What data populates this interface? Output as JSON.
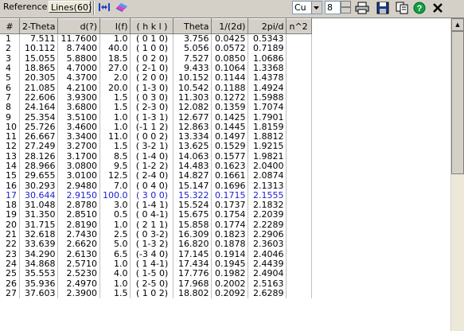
{
  "toolbar": {
    "reference_tab": "Reference",
    "lines_tab": "Lines(60)",
    "radiation": "Cu",
    "font_size": "8",
    "icons": [
      "fit-width-icon",
      "eraser-icon",
      "print-icon",
      "save-icon",
      "copy-icon",
      "help-icon",
      "close-icon"
    ]
  },
  "table": {
    "headers": [
      "#",
      "2-Theta",
      "d(?)",
      "I(f)",
      "( h k l )",
      "Theta",
      "1/(2d)",
      "2pi/d",
      "n^2"
    ],
    "selected_row": 17,
    "selected_color": "#2020d0",
    "rows": [
      [
        "1",
        "7.511",
        "11.7600",
        "1.0",
        "( 0 1 0)",
        "3.756",
        "0.0425",
        "0.5343",
        ""
      ],
      [
        "2",
        "10.112",
        "8.7400",
        "40.0",
        "( 1 0 0)",
        "5.056",
        "0.0572",
        "0.7189",
        ""
      ],
      [
        "3",
        "15.055",
        "5.8800",
        "18.5",
        "( 0 2 0)",
        "7.527",
        "0.0850",
        "1.0686",
        ""
      ],
      [
        "4",
        "18.865",
        "4.7000",
        "27.0",
        "( 2-1 0)",
        "9.433",
        "0.1064",
        "1.3368",
        ""
      ],
      [
        "5",
        "20.305",
        "4.3700",
        "2.0",
        "( 2 0 0)",
        "10.152",
        "0.1144",
        "1.4378",
        ""
      ],
      [
        "6",
        "21.085",
        "4.2100",
        "20.0",
        "( 1-3 0)",
        "10.542",
        "0.1188",
        "1.4924",
        ""
      ],
      [
        "7",
        "22.606",
        "3.9300",
        "1.5",
        "( 0 3 0)",
        "11.303",
        "0.1272",
        "1.5988",
        ""
      ],
      [
        "8",
        "24.164",
        "3.6800",
        "1.5",
        "( 2-3 0)",
        "12.082",
        "0.1359",
        "1.7074",
        ""
      ],
      [
        "9",
        "25.354",
        "3.5100",
        "1.0",
        "( 1-3 1)",
        "12.677",
        "0.1425",
        "1.7901",
        ""
      ],
      [
        "10",
        "25.726",
        "3.4600",
        "1.0",
        "(-1 1 2)",
        "12.863",
        "0.1445",
        "1.8159",
        ""
      ],
      [
        "11",
        "26.667",
        "3.3400",
        "11.0",
        "( 0 0 2)",
        "13.334",
        "0.1497",
        "1.8812",
        ""
      ],
      [
        "12",
        "27.249",
        "3.2700",
        "1.5",
        "( 3-2 1)",
        "13.625",
        "0.1529",
        "1.9215",
        ""
      ],
      [
        "13",
        "28.126",
        "3.1700",
        "8.5",
        "( 1-4 0)",
        "14.063",
        "0.1577",
        "1.9821",
        ""
      ],
      [
        "14",
        "28.966",
        "3.0800",
        "9.5",
        "( 1-2 2)",
        "14.483",
        "0.1623",
        "2.0400",
        ""
      ],
      [
        "15",
        "29.655",
        "3.0100",
        "12.5",
        "( 2-4 0)",
        "14.827",
        "0.1661",
        "2.0874",
        ""
      ],
      [
        "16",
        "30.293",
        "2.9480",
        "7.0",
        "( 0 4 0)",
        "15.147",
        "0.1696",
        "2.1313",
        ""
      ],
      [
        "17",
        "30.644",
        "2.9150",
        "100.0",
        "( 3 0 0)",
        "15.322",
        "0.1715",
        "2.1555",
        ""
      ],
      [
        "18",
        "31.048",
        "2.8780",
        "3.0",
        "( 1-4 1)",
        "15.524",
        "0.1737",
        "2.1832",
        ""
      ],
      [
        "19",
        "31.350",
        "2.8510",
        "0.5",
        "( 0 4-1)",
        "15.675",
        "0.1754",
        "2.2039",
        ""
      ],
      [
        "20",
        "31.715",
        "2.8190",
        "1.0",
        "( 2 1 1)",
        "15.858",
        "0.1774",
        "2.2289",
        ""
      ],
      [
        "21",
        "32.618",
        "2.7430",
        "2.5",
        "( 0 3-2)",
        "16.309",
        "0.1823",
        "2.2906",
        ""
      ],
      [
        "22",
        "33.639",
        "2.6620",
        "5.0",
        "( 1-3 2)",
        "16.820",
        "0.1878",
        "2.3603",
        ""
      ],
      [
        "23",
        "34.290",
        "2.6130",
        "6.5",
        "(-3 4 0)",
        "17.145",
        "0.1914",
        "2.4046",
        ""
      ],
      [
        "24",
        "34.868",
        "2.5710",
        "1.0",
        "( 1 4-1)",
        "17.434",
        "0.1945",
        "2.4439",
        ""
      ],
      [
        "25",
        "35.553",
        "2.5230",
        "4.0",
        "( 1-5 0)",
        "17.776",
        "0.1982",
        "2.4904",
        ""
      ],
      [
        "26",
        "35.936",
        "2.4970",
        "1.0",
        "( 2-5 0)",
        "17.968",
        "0.2002",
        "2.5163",
        ""
      ],
      [
        "27",
        "37.603",
        "2.3900",
        "1.5",
        "( 1 0 2)",
        "18.802",
        "0.2092",
        "2.6289",
        ""
      ]
    ]
  }
}
